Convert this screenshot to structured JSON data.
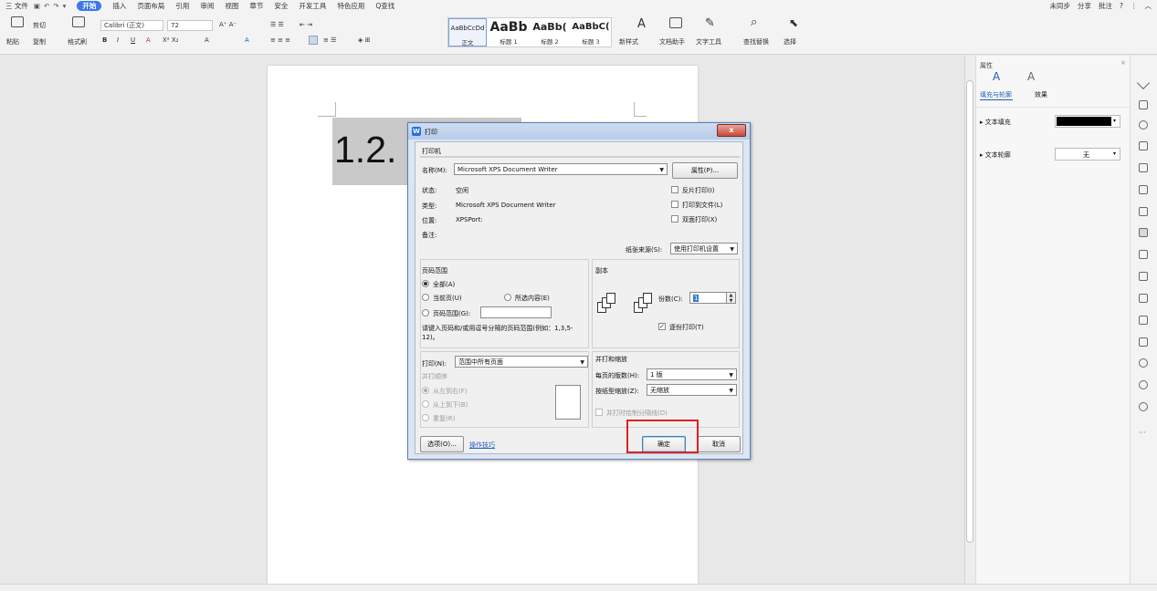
{
  "menubar": {
    "file_label": "三 文件",
    "tabs": [
      "开始",
      "插入",
      "页面布局",
      "引用",
      "审阅",
      "视图",
      "章节",
      "安全",
      "开发工具",
      "特色应用",
      "Q查找"
    ],
    "active_tab": "开始",
    "right_items": [
      "未同步",
      "分享",
      "批注",
      "?",
      "⋮",
      "︿"
    ]
  },
  "ribbon": {
    "paste_label": "粘贴",
    "cut_label": "剪切",
    "copy_label": "复制",
    "format_painter_label": "格式刷",
    "font_name": "Calibri (正文)",
    "font_size": "72",
    "bold": "B",
    "italic": "I",
    "underline": "U",
    "styles": [
      {
        "preview": "AaBbCcDd",
        "label": "正文"
      },
      {
        "preview": "AaBb",
        "label": "标题 1"
      },
      {
        "preview": "AaBb(",
        "label": "标题 2"
      },
      {
        "preview": "AaBbC(",
        "label": "标题 3"
      }
    ],
    "new_style_label": "新样式",
    "text_assistant_label": "文档助手",
    "text_tools_label": "文字工具",
    "find_replace_label": "查找替换",
    "select_label": "选择"
  },
  "document": {
    "heading_text": "1.2."
  },
  "panel": {
    "title": "属性",
    "tab_fill": "填充与轮廓",
    "tab_effect": "效果",
    "text_fill_label": "文本填充",
    "text_outline_label": "文本轮廓",
    "text_outline_value": "无",
    "fill_color": "#000000"
  },
  "dialog": {
    "title": "打印",
    "close_label": "x",
    "printer_group": "打印机",
    "name_label": "名称(M):",
    "printer_name": "Microsoft XPS Document Writer",
    "properties_button": "属性(P)...",
    "status_label": "状态:",
    "status_value": "空闲",
    "type_label": "类型:",
    "type_value": "Microsoft XPS Document Writer",
    "location_label": "位置:",
    "location_value": "XPSPort:",
    "comment_label": "备注:",
    "reverse_print": "反片打印(I)",
    "print_to_file": "打印到文件(L)",
    "duplex_print": "双面打印(X)",
    "paper_source_label": "纸张来源(S):",
    "paper_source_value": "使用打印机设置",
    "page_range_group": "页码范围",
    "all_label": "全部(A)",
    "current_page_label": "当前页(U)",
    "selection_label": "所选内容(E)",
    "page_range_label": "页码范围(G):",
    "page_range_hint": "请键入页码和/或用逗号分隔的页码范围(例如：1,3,5-12)。",
    "copies_group": "副本",
    "copies_label": "份数(C):",
    "copies_value": "1",
    "collate_label": "逐份打印(T)",
    "print_label": "打印(N):",
    "print_value": "范围中所有页面",
    "print_order_label": "并打顺序",
    "left_to_right": "从左到右(F)",
    "top_to_bottom": "从上到下(B)",
    "repeat_label": "重复(R)",
    "zoom_group": "并打和缩放",
    "pages_per_sheet_label": "每页的版数(H):",
    "pages_per_sheet_value": "1 版",
    "scale_label": "按纸型缩放(Z):",
    "scale_value": "无缩放",
    "draw_dividers_label": "并打时绘制分隔线(D)",
    "options_button": "选项(O)...",
    "tips_link": "操作技巧",
    "ok_button": "确定",
    "cancel_button": "取消"
  }
}
